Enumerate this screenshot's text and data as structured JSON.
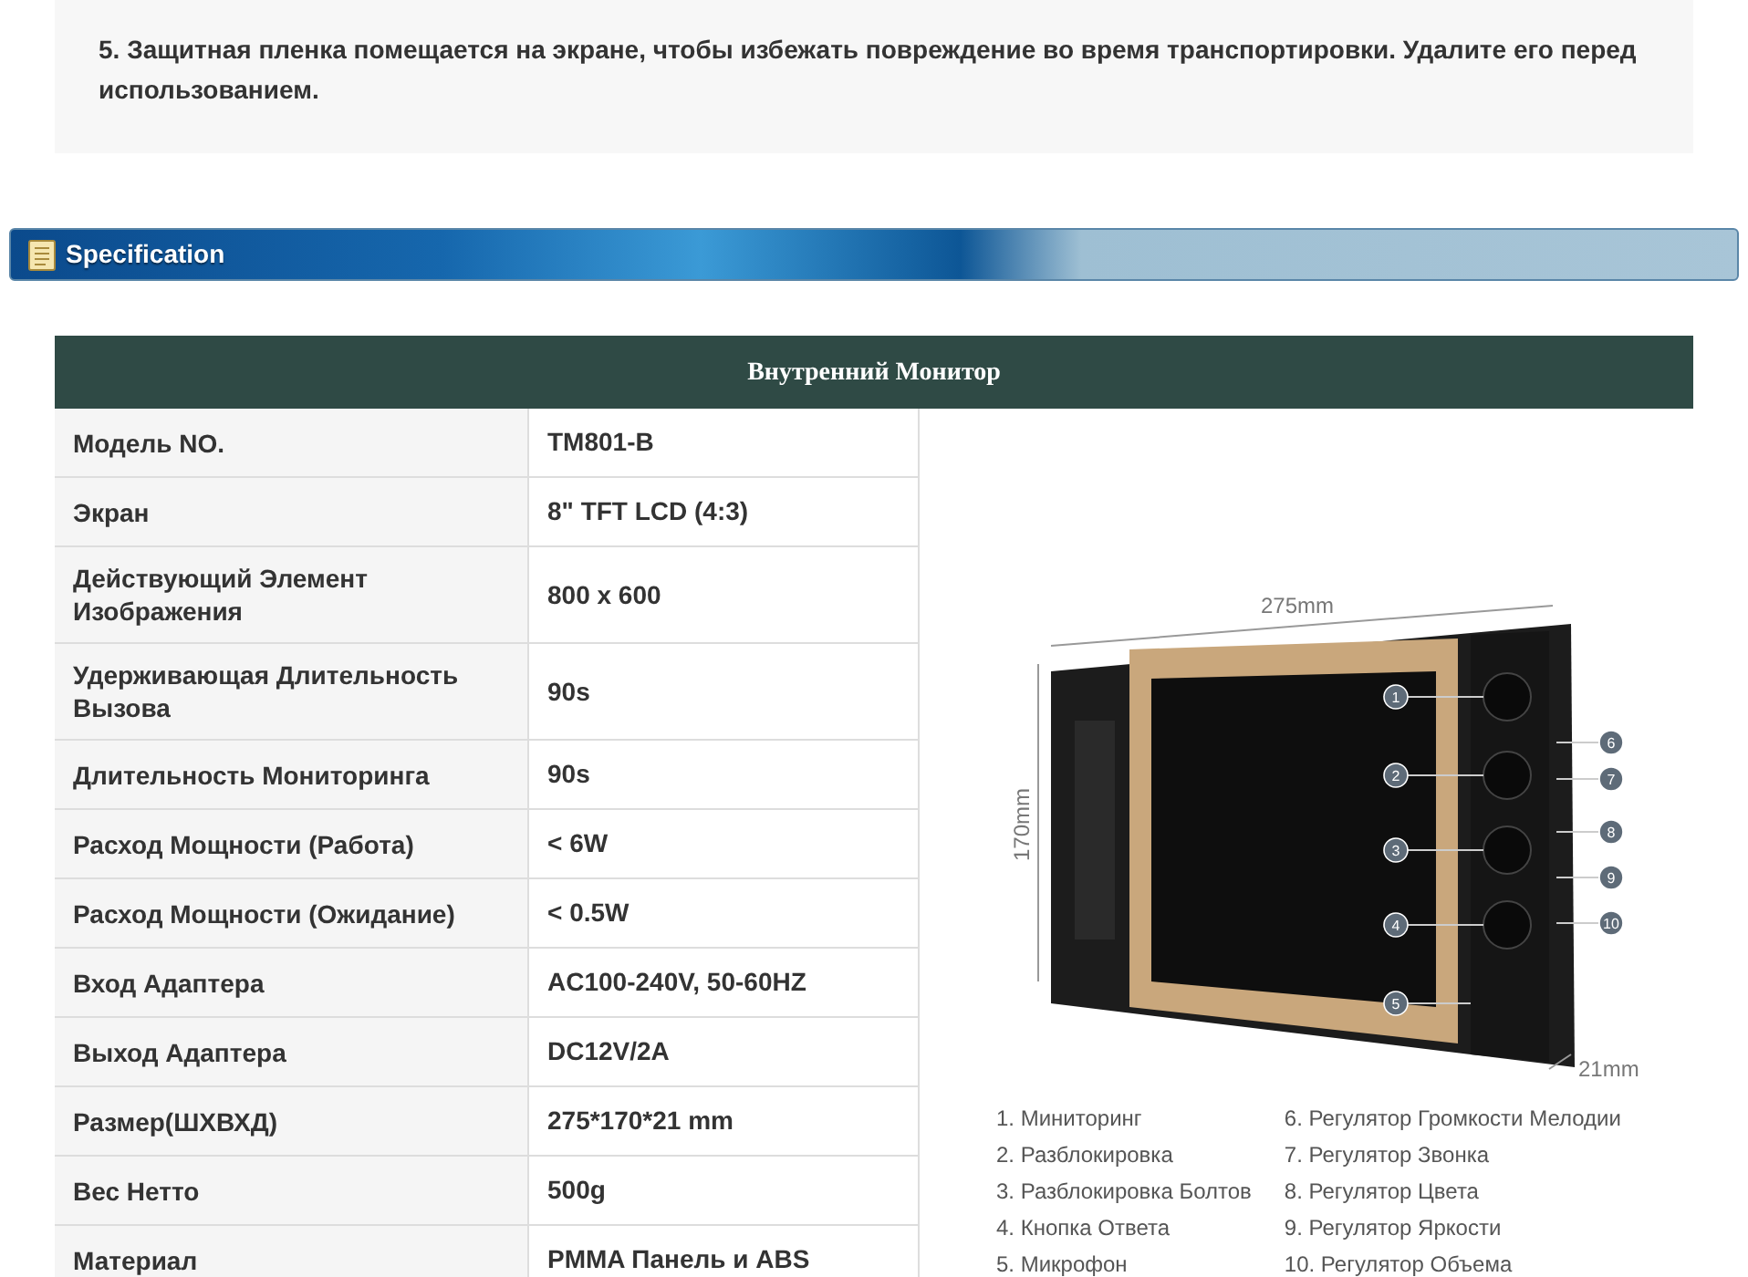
{
  "notice": {
    "text": "5. Защитная пленка помещается на экране, чтобы избежать повреждение во время транспортировки. Удалите его перед использованием."
  },
  "section_header": {
    "title": "Specification"
  },
  "table": {
    "title": "Внутренний Монитор",
    "rows": [
      {
        "label": "Модель NO.",
        "value": "TM801-B"
      },
      {
        "label": "Экран",
        "value": "8\" TFT LCD (4:3)"
      },
      {
        "label": "Действующий Элемент Изображения",
        "value": "800 x 600"
      },
      {
        "label": "Удерживающая Длительность Вызова",
        "value": "90s"
      },
      {
        "label": "Длительность Мониторинга",
        "value": "90s"
      },
      {
        "label": "Расход Мощности (Работа)",
        "value": "< 6W"
      },
      {
        "label": "Расход Мощности (Ожидание)",
        "value": "< 0.5W"
      },
      {
        "label": "Вход Адаптера",
        "value": "AC100-240V, 50-60HZ"
      },
      {
        "label": "Выход Адаптера",
        "value": "DC12V/2A"
      },
      {
        "label": "Размер(ШХВХД)",
        "value": "275*170*21 mm"
      },
      {
        "label": "Вес Нетто",
        "value": "500g"
      },
      {
        "label": "Материал",
        "value": "PMMA Панель и ABS"
      }
    ]
  },
  "diagram": {
    "width_label": "275mm",
    "height_label": "170mm",
    "depth_label": "21mm",
    "callouts": [
      "1",
      "2",
      "3",
      "4",
      "5",
      "6",
      "7",
      "8",
      "9",
      "10"
    ],
    "legend": [
      "1. Миниторинг",
      "2. Разблокировка",
      "3. Разблокировка Болтов",
      "4. Кнопка Ответа",
      "5. Микрофон",
      "6. Регулятор Громкости Мелодии",
      "7. Регулятор Звонка",
      "8. Регулятор Цвета",
      "9. Регулятор Яркости",
      "10. Регулятор Объема"
    ]
  }
}
